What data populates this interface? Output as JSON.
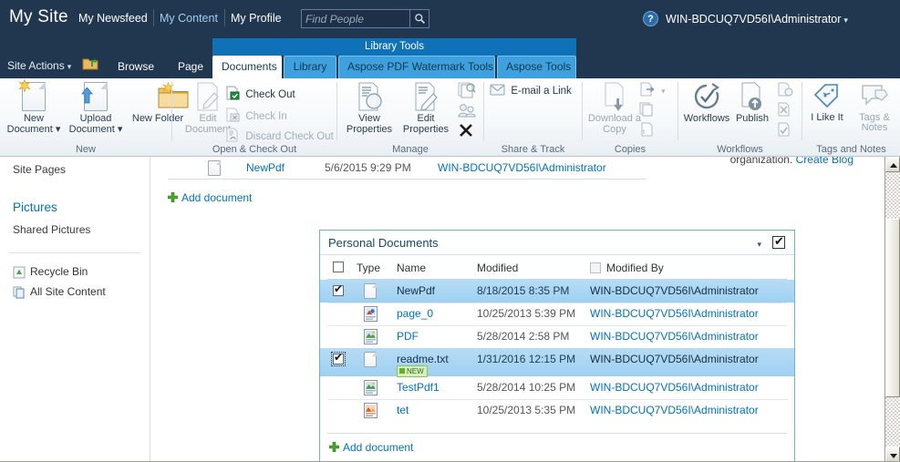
{
  "suitebar": {
    "logo": "My Site",
    "links": [
      {
        "label": "My Newsfeed",
        "active": false
      },
      {
        "label": "My Content",
        "active": true
      },
      {
        "label": "My Profile",
        "active": false
      }
    ],
    "search_placeholder": "Find People",
    "search_value": "",
    "search_icon": "search-icon",
    "help_label": "?",
    "user": "WIN-BDCUQ7VD56I\\Administrator",
    "user_caret": "▾"
  },
  "ribbon_header": {
    "contextual_banner": "Library Tools",
    "site_actions": "Site Actions",
    "site_actions_caret": "▾",
    "tabs": [
      {
        "label": "Browse",
        "type": "plain"
      },
      {
        "label": "Page",
        "type": "plain"
      },
      {
        "label": "Documents",
        "type": "ctx",
        "selected": true
      },
      {
        "label": "Library",
        "type": "ctx",
        "selected": false
      },
      {
        "label": "Aspose PDF Watermark Tools",
        "type": "ctx",
        "selected": false
      },
      {
        "label": "Aspose Tools",
        "type": "ctx",
        "selected": false
      }
    ]
  },
  "ribbon": {
    "groups": [
      {
        "name": "New",
        "big_buttons": [
          {
            "label": "New Document",
            "icon": "new-document-icon",
            "has_caret": true,
            "disabled": false
          },
          {
            "label": "Upload Document",
            "icon": "upload-document-icon",
            "has_caret": true,
            "disabled": false
          },
          {
            "label": "New Folder",
            "icon": "new-folder-icon",
            "has_caret": false,
            "disabled": false
          }
        ],
        "small_buttons": []
      },
      {
        "name": "Open & Check Out",
        "big_buttons": [
          {
            "label": "Edit Document",
            "icon": "edit-document-icon",
            "has_caret": false,
            "disabled": true
          }
        ],
        "small_buttons": [
          {
            "label": "Check Out",
            "icon": "check-out-icon",
            "disabled": false
          },
          {
            "label": "Check In",
            "icon": "check-in-icon",
            "disabled": true
          },
          {
            "label": "Discard Check Out",
            "icon": "discard-check-out-icon",
            "disabled": true
          }
        ]
      },
      {
        "name": "Manage",
        "big_buttons": [
          {
            "label": "View Properties",
            "icon": "view-properties-icon",
            "has_caret": false,
            "disabled": false
          },
          {
            "label": "Edit Properties",
            "icon": "edit-properties-icon",
            "has_caret": false,
            "disabled": false
          }
        ],
        "small_buttons": [
          {
            "label": "",
            "icon": "version-history-icon",
            "disabled": true
          },
          {
            "label": "",
            "icon": "document-permissions-icon",
            "disabled": true
          },
          {
            "label": "",
            "icon": "delete-document-icon",
            "disabled": false
          }
        ]
      },
      {
        "name": "Share & Track",
        "big_buttons": [],
        "small_buttons": [
          {
            "label": "E-mail a Link",
            "icon": "email-a-link-icon",
            "disabled": false
          }
        ]
      },
      {
        "name": "Copies",
        "big_buttons": [
          {
            "label": "Download a Copy",
            "icon": "download-a-copy-icon",
            "has_caret": false,
            "disabled": true
          }
        ],
        "small_buttons": [
          {
            "label": "",
            "icon": "send-to-icon",
            "disabled": true,
            "has_caret": true
          },
          {
            "label": "",
            "icon": "manage-copies-icon",
            "disabled": true
          },
          {
            "label": "",
            "icon": "go-to-source-icon",
            "disabled": true
          }
        ]
      },
      {
        "name": "Workflows",
        "big_buttons": [
          {
            "label": "Workflows",
            "icon": "workflows-icon",
            "has_caret": false,
            "disabled": false
          },
          {
            "label": "Publish",
            "icon": "publish-icon",
            "has_caret": false,
            "disabled": false
          }
        ],
        "small_buttons": [
          {
            "label": "",
            "icon": "approve-reject-icon",
            "disabled": true
          },
          {
            "label": "",
            "icon": "cancel-approval-icon",
            "disabled": true
          },
          {
            "label": "",
            "icon": "manage-workflow-icon",
            "disabled": true
          }
        ]
      },
      {
        "name": "Tags and Notes",
        "big_buttons": [
          {
            "label": "I Like It",
            "icon": "i-like-it-icon",
            "has_caret": false,
            "disabled": false
          },
          {
            "label": "Tags & Notes",
            "icon": "tags-and-notes-icon",
            "has_caret": false,
            "disabled": true
          }
        ],
        "small_buttons": []
      }
    ]
  },
  "quicklaunch": {
    "top_item": "Site Pages",
    "pictures_header": "Pictures",
    "pictures_items": [
      "Shared Pictures"
    ],
    "bottom_items": [
      {
        "label": "Recycle Bin",
        "icon": "recycle-bin-icon"
      },
      {
        "label": "All Site Content",
        "icon": "all-site-content-icon"
      }
    ]
  },
  "main": {
    "top_note_text": "organization.",
    "top_note_link": "Create Blog",
    "upper_list": {
      "rows": [
        {
          "icon": "blank-document-icon",
          "name": "NewPdf",
          "modified": "5/6/2015 9:29 PM",
          "modified_by": "WIN-BDCUQ7VD56I\\Administrator"
        }
      ],
      "add_document": "Add document"
    },
    "webpart": {
      "title": "Personal Documents",
      "caret": "▾",
      "header_checkbox_checked": true,
      "columns": [
        {
          "label": "",
          "type": "checkbox"
        },
        {
          "label": "Type"
        },
        {
          "label": "Name"
        },
        {
          "label": "Modified"
        },
        {
          "label": "Modified By",
          "has_checkbox": true
        }
      ],
      "rows": [
        {
          "selected": true,
          "checked": true,
          "focused": false,
          "icon": "blank-document-icon",
          "name": "NewPdf",
          "modified": "8/18/2015 8:35 PM",
          "modified_by": "WIN-BDCUQ7VD56I\\Administrator",
          "badge": ""
        },
        {
          "selected": false,
          "checked": false,
          "focused": false,
          "icon": "powerpoint-document-icon",
          "name": "page_0",
          "modified": "10/25/2013 5:39 PM",
          "modified_by": "WIN-BDCUQ7VD56I\\Administrator",
          "badge": ""
        },
        {
          "selected": false,
          "checked": false,
          "focused": false,
          "icon": "picture-document-icon",
          "name": "PDF",
          "modified": "5/28/2014 2:58 PM",
          "modified_by": "WIN-BDCUQ7VD56I\\Administrator",
          "badge": ""
        },
        {
          "selected": true,
          "checked": true,
          "focused": true,
          "icon": "blank-document-icon",
          "name": "readme.txt",
          "modified": "1/31/2016 12:15 PM",
          "modified_by": "WIN-BDCUQ7VD56I\\Administrator",
          "badge": "NEW"
        },
        {
          "selected": false,
          "checked": false,
          "focused": false,
          "icon": "picture-document-icon",
          "name": "TestPdf1",
          "modified": "5/28/2014 10:25 PM",
          "modified_by": "WIN-BDCUQ7VD56I\\Administrator",
          "badge": ""
        },
        {
          "selected": false,
          "checked": false,
          "focused": false,
          "icon": "powerpoint-orange-document-icon",
          "name": "tet",
          "modified": "10/25/2013 5:35 PM",
          "modified_by": "WIN-BDCUQ7VD56I\\Administrator",
          "badge": ""
        }
      ],
      "add_document": "Add document"
    }
  },
  "scrollbar": {
    "up_arrow": "scroll-up-arrow-icon",
    "down_arrow": "scroll-down-arrow-icon"
  },
  "colors": {
    "suitebar_bg": "#21374f",
    "contextual_banner": "#0f72b9",
    "link": "#0072c6",
    "selection": "#9fd0f1",
    "webpart_border": "#6bb1e0"
  }
}
